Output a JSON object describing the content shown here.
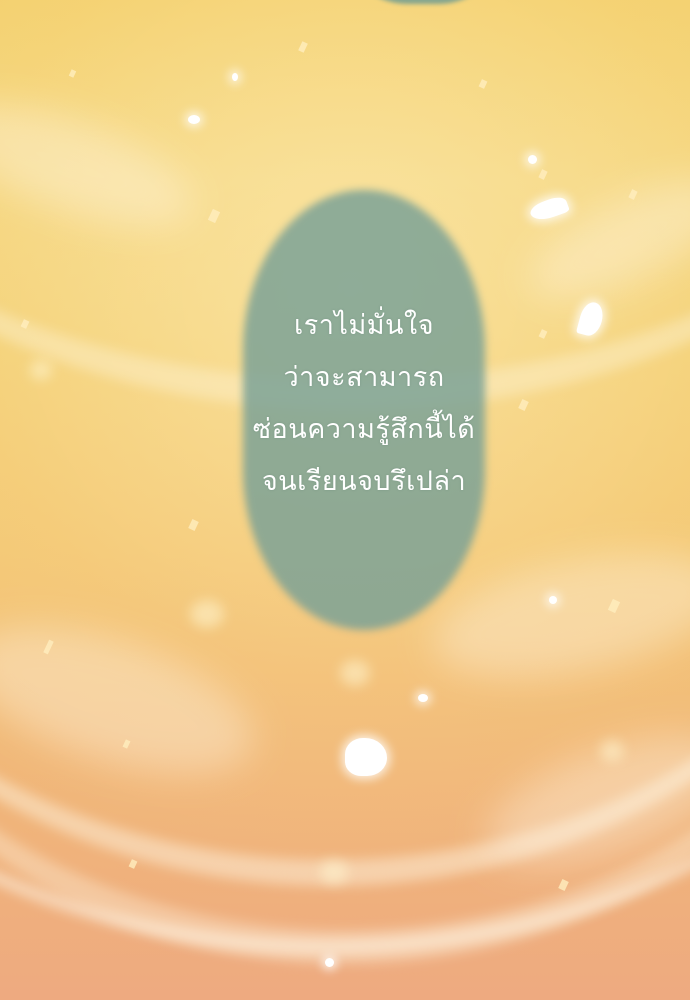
{
  "narration": {
    "lines": [
      "เราไม่มั่นใจ",
      "ว่าจะสามารถ",
      "ซ่อนความรู้สึกนี้ได้",
      "จนเรียนจบรึเปล่า"
    ]
  },
  "colors": {
    "sky_top": "#f3cf6c",
    "sky_bottom": "#eeaa80",
    "bubble": "#789f96",
    "text": "#ffffff"
  }
}
